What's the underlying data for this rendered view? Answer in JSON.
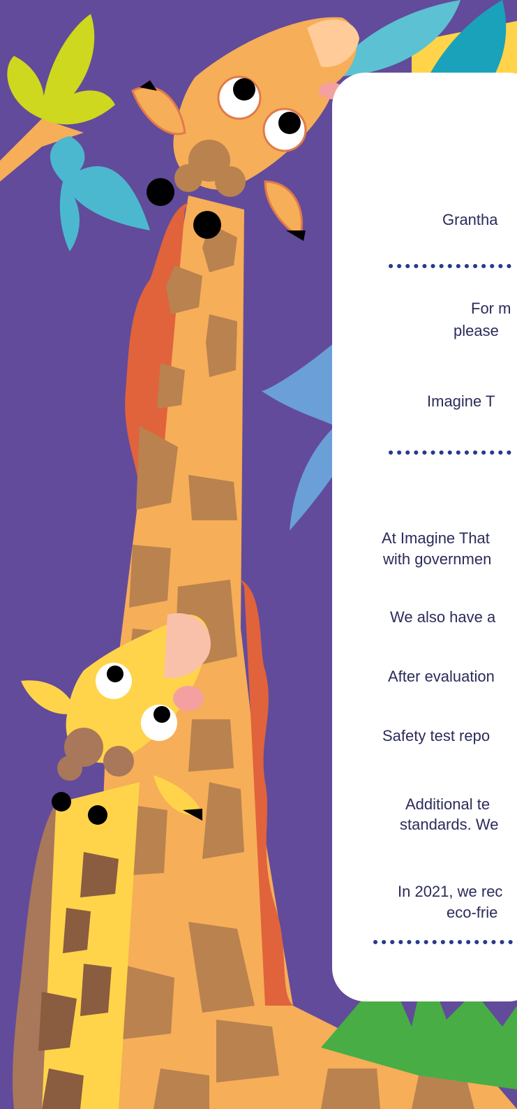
{
  "content": {
    "address_line": "Grantha",
    "contact_line1": "For m",
    "contact_line2": "please",
    "company_line": "Imagine T",
    "safety_intro_line1": "At Imagine That",
    "safety_intro_line2": "with governmen",
    "also_line": "We also have a",
    "evaluation_line": "After evaluation",
    "reports_line": "Safety test repo",
    "additional_line1": "Additional te",
    "additional_line2": "standards. We",
    "eco_line1": "In 2021, we rec",
    "eco_line2": "eco-frie"
  },
  "colors": {
    "background": "#624b9a",
    "giraffe_orange": "#f6ae58",
    "giraffe_yellow": "#ffd44a",
    "spots_brown": "#b9824f",
    "mane_red": "#e0633c",
    "leaf_teal": "#28a9c2",
    "leaf_lime": "#cdd81e",
    "grass_green": "#48ad44",
    "dot_navy": "#283a8a",
    "text": "#2b2b5a"
  }
}
